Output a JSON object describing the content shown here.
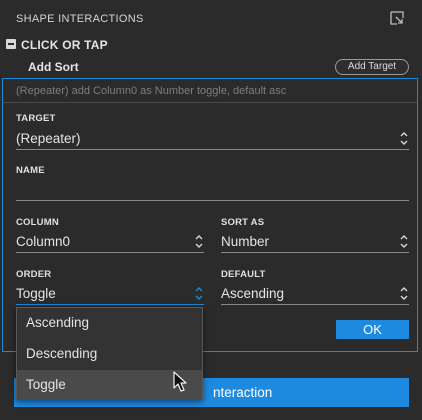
{
  "panel": {
    "title": "SHAPE INTERACTIONS",
    "popout_icon": "popout-icon"
  },
  "section": {
    "label": "CLICK OR TAP",
    "collapse_icon": "collapse-minus-icon"
  },
  "action": {
    "label": "Add Sort",
    "add_target_label": "Add Target"
  },
  "editor": {
    "summary": "(Repeater) add Column0 as Number toggle, default asc",
    "target": {
      "label": "TARGET",
      "value": "(Repeater)"
    },
    "name": {
      "label": "NAME",
      "value": ""
    },
    "column": {
      "label": "COLUMN",
      "value": "Column0"
    },
    "sort_as": {
      "label": "SORT AS",
      "value": "Number"
    },
    "order": {
      "label": "ORDER",
      "value": "Toggle"
    },
    "default": {
      "label": "DEFAULT",
      "value": "Ascending"
    },
    "ok_label": "OK"
  },
  "dropdown": {
    "options": [
      "Ascending",
      "Descending",
      "Toggle"
    ],
    "highlighted": "Toggle"
  },
  "bottom_button": {
    "label": "nteraction"
  },
  "colors": {
    "accent": "#1d8ae0",
    "focus_border": "#1c8ad6",
    "background": "#2b2b2b"
  }
}
